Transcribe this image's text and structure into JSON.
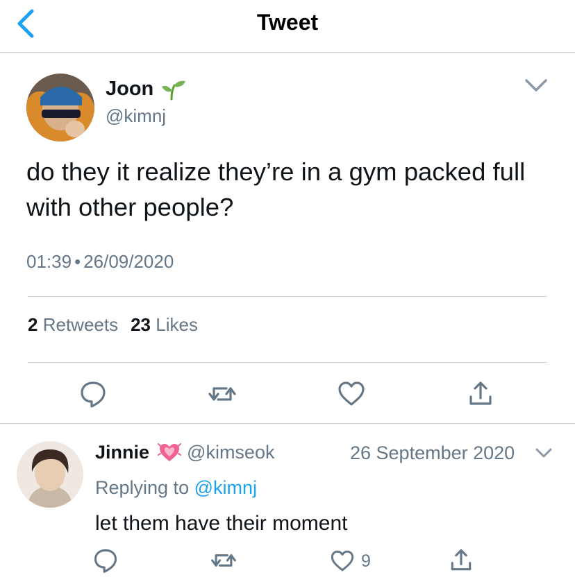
{
  "header": {
    "title": "Tweet"
  },
  "tweet": {
    "author": {
      "name": "Joon",
      "handle": "@kimnj"
    },
    "text": "do they it realize they’re in a gym packed full with other people?",
    "time": "01:39",
    "date": "26/09/2020",
    "stats": {
      "retweets": "2",
      "retweets_label": "Retweets",
      "likes": "23",
      "likes_label": "Likes"
    }
  },
  "reply": {
    "author": {
      "name": "Jinnie",
      "handle": "@kimseok"
    },
    "date": "26 September 2020",
    "replying_prefix": "Replying to",
    "replying_to": "@kimnj",
    "text": "let them have their moment",
    "like_count": "9"
  },
  "icons": {
    "back": "chevron-left-icon",
    "caret": "chevron-down-icon",
    "reply": "speech-bubble-icon",
    "retweet": "retweet-icon",
    "like": "heart-outline-icon",
    "share": "share-icon",
    "name_emoji": "seedling-emoji",
    "reply_name_emoji": "growing-heart-emoji"
  },
  "colors": {
    "accent": "#1da1f2",
    "secondary_text": "#657786",
    "primary_text": "#0f1419",
    "divider": "#d0d5d9"
  }
}
